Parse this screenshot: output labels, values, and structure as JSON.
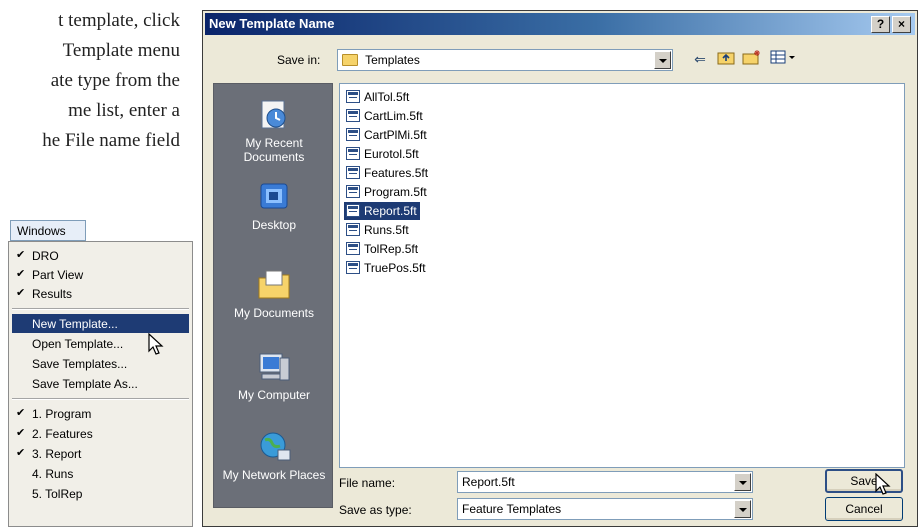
{
  "manual_text": {
    "lines": [
      "t template, click",
      "Template menu",
      "ate type from the",
      "me list, enter a",
      "he File name field"
    ]
  },
  "windows_menu": {
    "title": "Windows",
    "items": [
      {
        "label": "DRO",
        "checked": true
      },
      {
        "label": "Part View",
        "checked": true
      },
      {
        "label": "Results",
        "checked": true
      },
      {
        "label": "New Template...",
        "checked": false,
        "selected": true
      },
      {
        "label": "Open Template...",
        "checked": false
      },
      {
        "label": "Save Templates...",
        "checked": false
      },
      {
        "label": "Save Template As...",
        "checked": false
      },
      {
        "label": "1. Program",
        "checked": true
      },
      {
        "label": "2. Features",
        "checked": true
      },
      {
        "label": "3. Report",
        "checked": true
      },
      {
        "label": "4. Runs",
        "checked": false
      },
      {
        "label": "5. TolRep",
        "checked": false
      }
    ],
    "check_glyph": "✔"
  },
  "dialog": {
    "title": "New Template Name",
    "title_buttons": {
      "help": "?",
      "close": "×"
    },
    "save_in_label": "Save in:",
    "save_in_value": "Templates",
    "places": [
      {
        "label": "My Recent Documents",
        "icon": "recent-documents-icon"
      },
      {
        "label": "Desktop",
        "icon": "desktop-icon"
      },
      {
        "label": "My Documents",
        "icon": "my-documents-icon"
      },
      {
        "label": "My Computer",
        "icon": "my-computer-icon"
      },
      {
        "label": "My Network Places",
        "icon": "network-places-icon"
      }
    ],
    "files": [
      "AllTol.5ft",
      "CartLim.5ft",
      "CartPlMi.5ft",
      "Eurotol.5ft",
      "Features.5ft",
      "Program.5ft",
      "Report.5ft",
      "Runs.5ft",
      "TolRep.5ft",
      "TruePos.5ft"
    ],
    "selected_file": "Report.5ft",
    "file_name_label": "File name:",
    "file_name_value": "Report.5ft",
    "save_as_type_label": "Save as type:",
    "save_as_type_value": "Feature Templates",
    "save_button": "Save",
    "cancel_button": "Cancel"
  },
  "colors": {
    "selection": "#1e3b74",
    "dialog_bg": "#ece9d8",
    "places_bg": "#6b6f78"
  }
}
